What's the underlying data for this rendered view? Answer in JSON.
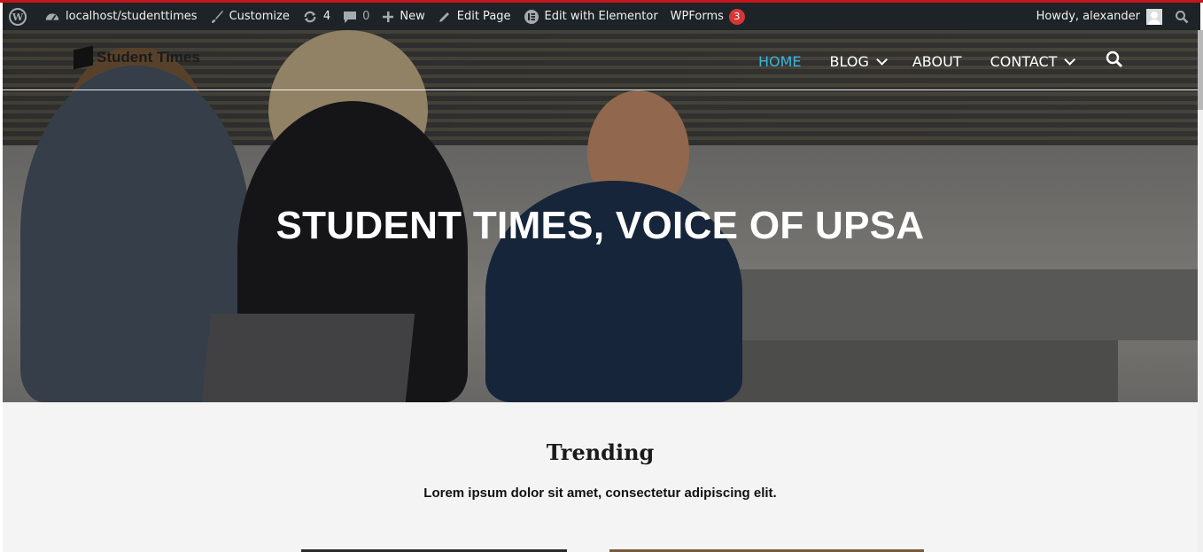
{
  "adminbar": {
    "site": "localhost/studenttimes",
    "customize": "Customize",
    "updates_count": "4",
    "comments_count": "0",
    "new": "New",
    "edit_page": "Edit Page",
    "edit_elementor": "Edit with Elementor",
    "wpforms": "WPForms",
    "wpforms_count": "3",
    "howdy": "Howdy, alexander"
  },
  "site": {
    "logo_text": "Student Times"
  },
  "nav": {
    "items": [
      {
        "label": "HOME"
      },
      {
        "label": "BLOG"
      },
      {
        "label": "ABOUT"
      },
      {
        "label": "CONTACT"
      }
    ]
  },
  "hero": {
    "title": "STUDENT TIMES, VOICE OF UPSA"
  },
  "section": {
    "title": "Trending",
    "subtitle": "Lorem ipsum dolor sit amet, consectetur adipiscing elit."
  },
  "colors": {
    "adminbar_bg": "#1d2327",
    "nav_active": "#39b4df",
    "badge": "#d63638"
  }
}
